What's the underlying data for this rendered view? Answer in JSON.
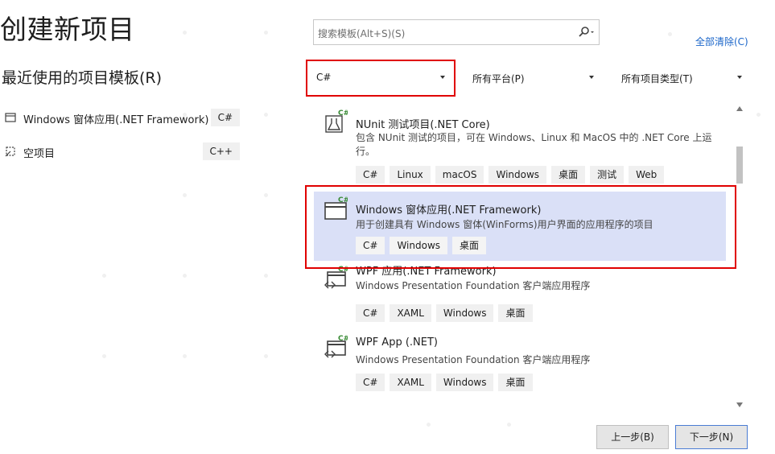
{
  "page": {
    "title": "创建新项目"
  },
  "recent": {
    "title": "最近使用的项目模板(R)",
    "items": [
      {
        "label": "Windows 窗体应用(.NET Framework)",
        "lang": "C#",
        "icon": "winforms-project-icon"
      },
      {
        "label": "空项目",
        "lang": "C++",
        "icon": "empty-project-icon"
      }
    ]
  },
  "search": {
    "placeholder": "搜索模板(Alt+S)(S)",
    "icon": "search-icon"
  },
  "clear_all": "全部清除(C)",
  "filters": {
    "language": "C#",
    "platform": "所有平台(P)",
    "project_type": "所有项目类型(T)"
  },
  "templates": [
    {
      "name": "NUnit 测试项目(.NET Core)",
      "description": "包含 NUnit 测试的项目，可在 Windows、Linux 和 MacOS 中的 .NET Core 上运行。",
      "tags": [
        "C#",
        "Linux",
        "macOS",
        "Windows",
        "桌面",
        "测试",
        "Web"
      ],
      "icon": "test-flask-icon",
      "selected": false
    },
    {
      "name": "Windows 窗体应用(.NET Framework)",
      "description": "用于创建具有 Windows 窗体(WinForms)用户界面的应用程序的项目",
      "tags": [
        "C#",
        "Windows",
        "桌面"
      ],
      "icon": "winforms-project-icon",
      "selected": true
    },
    {
      "name": "WPF 应用(.NET Framework)",
      "description": "Windows Presentation Foundation 客户端应用程序",
      "tags": [
        "C#",
        "XAML",
        "Windows",
        "桌面"
      ],
      "icon": "wpf-project-icon",
      "selected": false
    },
    {
      "name": "WPF App (.NET)",
      "description": "Windows Presentation Foundation 客户端应用程序",
      "tags": [
        "C#",
        "XAML",
        "Windows",
        "桌面"
      ],
      "icon": "wpf-project-icon",
      "selected": false
    }
  ],
  "buttons": {
    "back": "上一步(B)",
    "next": "下一步(N)"
  },
  "colors": {
    "highlight": "#e00000",
    "selected_bg": "#dae0f7",
    "link": "#1a65c9",
    "icon_green": "#388a34"
  }
}
